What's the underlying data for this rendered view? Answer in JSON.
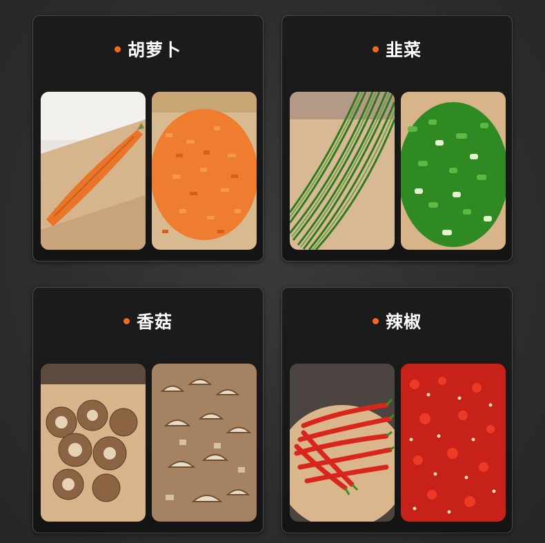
{
  "cards": [
    {
      "title": "胡萝卜",
      "images": [
        {
          "name": "whole-carrot-image",
          "icon": "whole-carrot"
        },
        {
          "name": "diced-carrot-image",
          "icon": "diced-carrot"
        }
      ]
    },
    {
      "title": "韭菜",
      "images": [
        {
          "name": "whole-chives-image",
          "icon": "chive-bundle"
        },
        {
          "name": "chopped-scallion-image",
          "icon": "chopped-green-onion"
        }
      ]
    },
    {
      "title": "香菇",
      "images": [
        {
          "name": "whole-shiitake-image",
          "icon": "shiitake-mushrooms"
        },
        {
          "name": "sliced-shiitake-image",
          "icon": "sliced-mushrooms"
        }
      ]
    },
    {
      "title": "辣椒",
      "images": [
        {
          "name": "whole-chili-image",
          "icon": "red-chili-peppers"
        },
        {
          "name": "chopped-chili-image",
          "icon": "chopped-chili"
        }
      ]
    }
  ],
  "colors": {
    "accent_dot": "#f26b1d",
    "card_background": "#181818",
    "page_background": "#2e2e2e",
    "title_text": "#ffffff"
  }
}
